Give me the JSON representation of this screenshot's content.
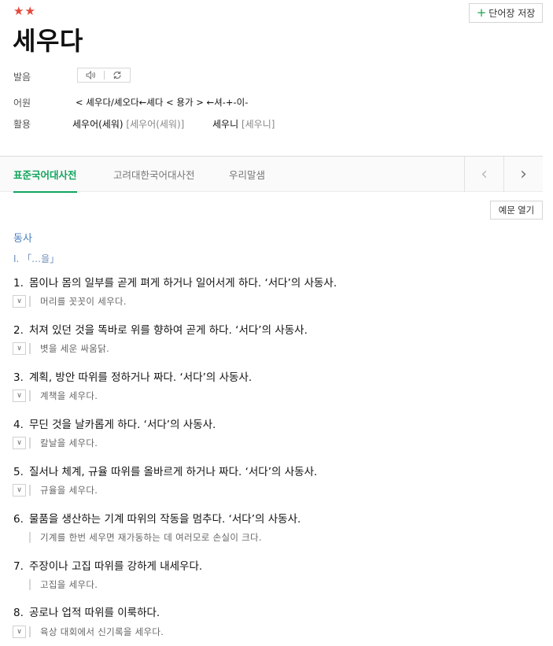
{
  "entry": {
    "stars": "★★",
    "headword": "세우다",
    "save_button": "단어장 저장",
    "save_plus": "+"
  },
  "info": {
    "pronunciation_label": "발음",
    "etymology_label": "어원",
    "etymology": "< 셰우다/셰오다←셰다 < 용가 > ←셔-+-이-",
    "conjugation_label": "활용",
    "conjugations": [
      {
        "form": "세우어(세워)",
        "pron": "[세우어(세워)]"
      },
      {
        "form": "세우니",
        "pron": "[세우니]"
      }
    ]
  },
  "tabs": [
    {
      "label": "표준국어대사전"
    },
    {
      "label": "고려대한국어대사전"
    },
    {
      "label": "우리말샘"
    }
  ],
  "nav": {
    "prev": "‹",
    "next": "›"
  },
  "example_toggle": "예문 열기",
  "part_of_speech": "동사",
  "roman_group": "I.   「…을」",
  "senses": [
    {
      "num": "1.",
      "def": "몸이나 몸의 일부를 곧게 펴게 하거나 일어서게 하다. ‘서다’의 사동사.",
      "example": "머리를 꼿꼿이 세우다.",
      "toggle": true
    },
    {
      "num": "2.",
      "def": "처져 있던 것을 똑바로 위를 향하여 곧게 하다. ‘서다’의 사동사.",
      "example": "볏을 세운 싸움닭.",
      "toggle": true
    },
    {
      "num": "3.",
      "def": "계획, 방안 따위를 정하거나 짜다. ‘서다’의 사동사.",
      "example": "계책을 세우다.",
      "toggle": true
    },
    {
      "num": "4.",
      "def": "무딘 것을 날카롭게 하다. ‘서다’의 사동사.",
      "example": "칼날을 세우다.",
      "toggle": true
    },
    {
      "num": "5.",
      "def": "질서나 체계, 규율 따위를 올바르게 하거나 짜다. ‘서다’의 사동사.",
      "example": "규율을 세우다.",
      "toggle": true
    },
    {
      "num": "6.",
      "def": "물품을 생산하는 기계 따위의 작동을 멈추다. ‘서다’의 사동사.",
      "example": "기계를 한번 세우면 재가동하는 데 여러모로 손실이 크다.",
      "toggle": false
    },
    {
      "num": "7.",
      "def": "주장이나 고집 따위를 강하게 내세우다.",
      "example": "고집을 세우다.",
      "toggle": false
    },
    {
      "num": "8.",
      "def": "공로나 업적 따위를 이룩하다.",
      "example": "육상 대회에서 신기록을 세우다.",
      "toggle": true
    }
  ],
  "icons": {
    "speaker": "speaker-icon",
    "repeat": "repeat-icon",
    "chevron": "chevron-down-icon"
  }
}
